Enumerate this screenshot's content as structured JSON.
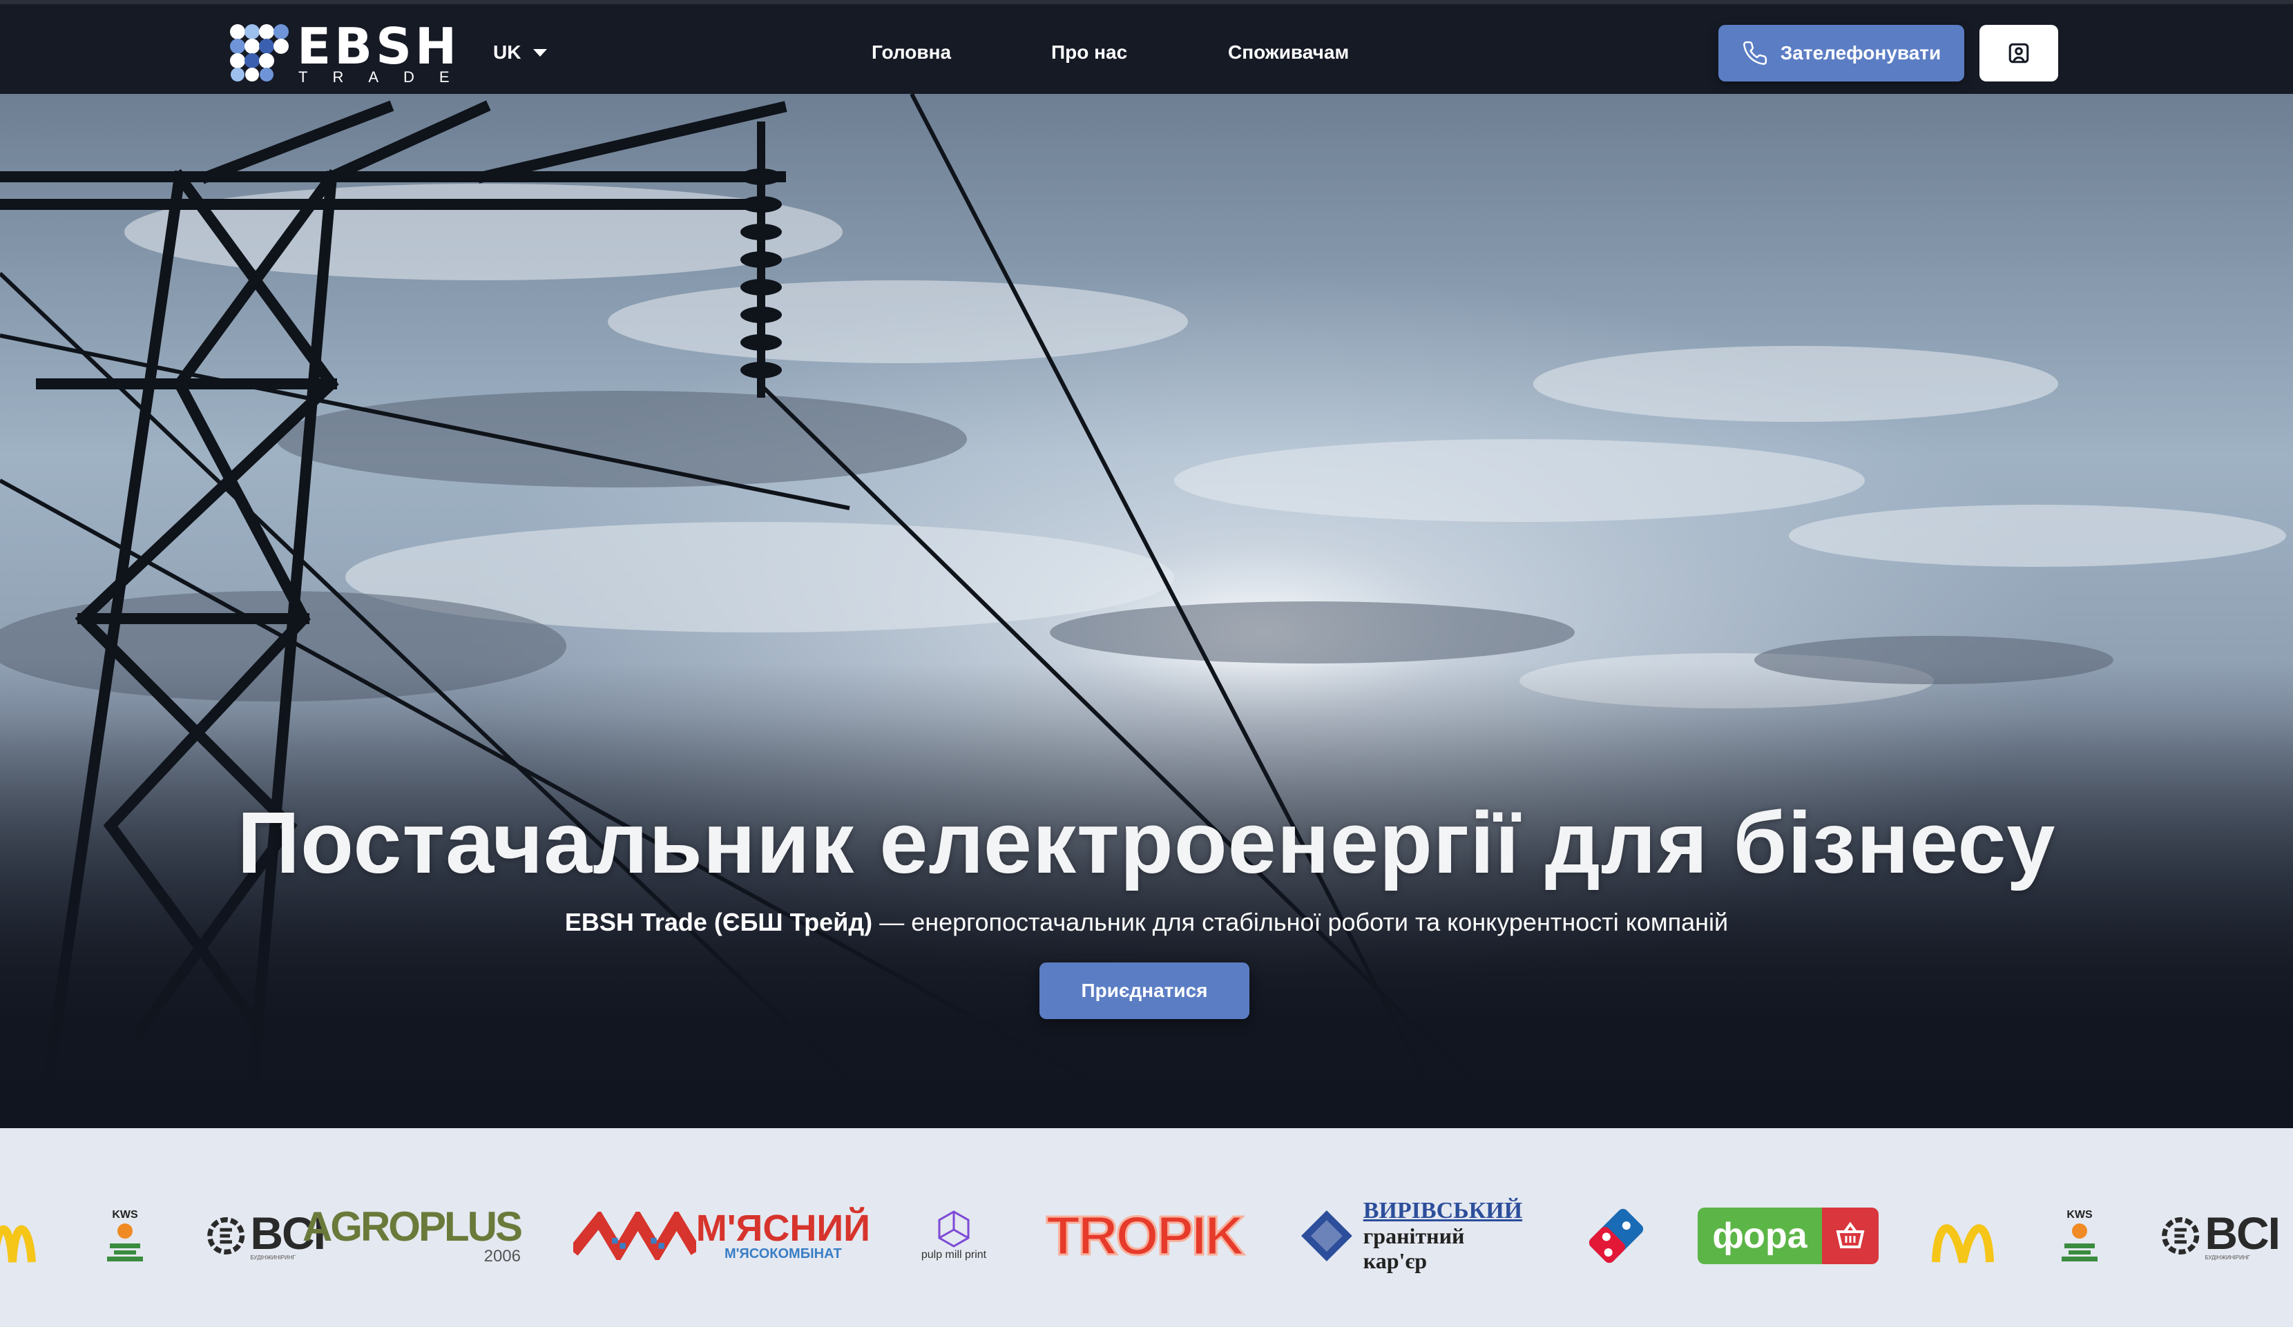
{
  "header": {
    "logo": {
      "word": "EBSH",
      "sub": "TRADE"
    },
    "language": "UK",
    "nav": [
      {
        "label": "Головна"
      },
      {
        "label": "Про нас"
      },
      {
        "label": "Споживачам"
      }
    ],
    "call_button": "Зателефонувати",
    "icons": {
      "phone": "phone-icon",
      "account": "user-square-icon",
      "caret": "caret-down-icon"
    }
  },
  "hero": {
    "title": "Постачальник електроенергії для бізнесу",
    "subtitle_brand": "EBSH Trade (ЄБШ Трейд)",
    "subtitle_rest": "— енергопостачальник для стабільної роботи та конкурентності компаній",
    "cta": "Приєднатися"
  },
  "clients": {
    "logos": [
      {
        "name": "mcdonalds",
        "text": "M"
      },
      {
        "name": "kws",
        "text": "KWS"
      },
      {
        "name": "bci",
        "text": "BCI",
        "sub": "БУДІНЖИНІРИНГ"
      },
      {
        "name": "agroplus",
        "text": "AGROPLUS",
        "sub": "2006"
      },
      {
        "name": "myasnyi",
        "text": "М'ЯСНИЙ",
        "sub": "М'ЯСОКОМБІНАТ"
      },
      {
        "name": "pulp-mill-print",
        "text": "pulp mill print"
      },
      {
        "name": "tropik",
        "text": "TROPIK"
      },
      {
        "name": "vyrivskyi",
        "text": "ВИРІВСЬКИЙ",
        "sub": "гранітний кар'єр"
      },
      {
        "name": "dominos",
        "text": ""
      },
      {
        "name": "fora",
        "text": "фора"
      },
      {
        "name": "mcdonalds-2",
        "text": "M"
      },
      {
        "name": "kws-2",
        "text": "KWS"
      },
      {
        "name": "bci-2",
        "text": "BCI",
        "sub": "БУДІНЖИНІРИНГ"
      }
    ]
  },
  "colors": {
    "header_bg": "#151a25",
    "accent": "#5b7dc4",
    "strip_bg": "#e4e8f0",
    "mcdonalds_yellow": "#f5c518",
    "tropik_red": "#e63a2b",
    "fora_green": "#5cb547",
    "fora_red": "#d9363e",
    "dominos_blue": "#1a6bb5",
    "vyrivskyi_blue": "#2c4e9b"
  }
}
